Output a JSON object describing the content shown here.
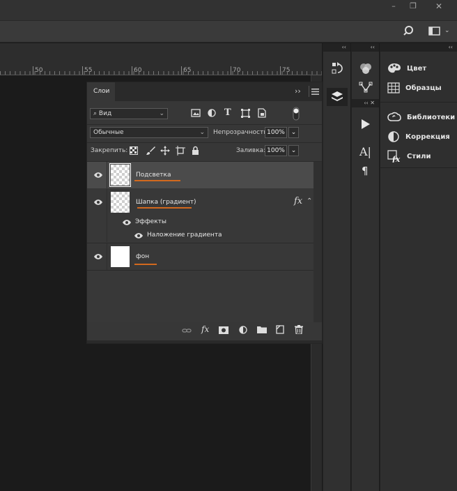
{
  "window_controls": {
    "minimize": "–",
    "restore": "❐",
    "close": "✕"
  },
  "ruler": {
    "labels": [
      "50",
      "55",
      "60",
      "65",
      "70",
      "75"
    ]
  },
  "layers_panel": {
    "tab_label": "Слои",
    "filter": {
      "label": "Вид"
    },
    "blend_mode": "Обычные",
    "opacity_label": "Непрозрачность:",
    "opacity_value": "100%",
    "lock_label": "Закрепить:",
    "fill_label": "Заливка:",
    "fill_value": "100%",
    "layers": [
      {
        "name": "Подсветка",
        "selected": true,
        "thumb": "transparent"
      },
      {
        "name": "Шапка (градиент)",
        "selected": false,
        "thumb": "transparent",
        "fx": "fx"
      },
      {
        "name": "фон",
        "selected": false,
        "thumb": "white"
      }
    ],
    "effects_label": "Эффекты",
    "effect_item": "Наложение градиента"
  },
  "right_panels": {
    "items": [
      {
        "label": "Цвет",
        "icon": "palette-icon"
      },
      {
        "label": "Образцы",
        "icon": "swatches-grid-icon"
      },
      {
        "label": "Библиотеки",
        "icon": "cc-libraries-icon"
      },
      {
        "label": "Коррекция",
        "icon": "adjustments-icon"
      },
      {
        "label": "Стили",
        "icon": "styles-fx-icon"
      }
    ]
  },
  "colors": {
    "accent_underline": "#d2691e",
    "selected_row": "#4b4b4b",
    "panel_bg": "#373737"
  }
}
